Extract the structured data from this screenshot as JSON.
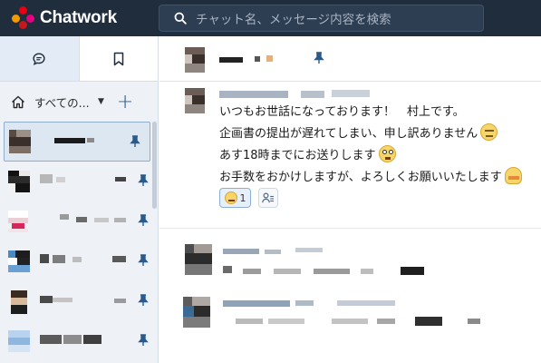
{
  "app": {
    "name": "Chatwork",
    "brand_colors": [
      "#e60012",
      "#f39800",
      "#e4007f",
      "#c8161d"
    ]
  },
  "search": {
    "placeholder": "チャット名、メッセージ内容を検索",
    "icon": "search-icon"
  },
  "sidebar": {
    "tabs": [
      {
        "name": "chat-list-tab",
        "icon": "chat-bubble-icon",
        "active": true
      },
      {
        "name": "bookmarks-tab",
        "icon": "bookmark-icon",
        "active": false
      }
    ],
    "filter": {
      "home_icon": "home-icon",
      "label": "すべての...",
      "caret": "▼",
      "add_label": "+"
    },
    "rooms": [
      {
        "pinned": true,
        "selected": true
      },
      {
        "pinned": true,
        "selected": false
      },
      {
        "pinned": true,
        "selected": false
      },
      {
        "pinned": true,
        "selected": false
      },
      {
        "pinned": true,
        "selected": false
      },
      {
        "pinned": true,
        "selected": false
      }
    ]
  },
  "chat": {
    "pinned": true,
    "messages": [
      {
        "lines": [
          "いつもお世話になっております！　村上です。",
          "企画書の提出が遅れてしまい、申し訳ありません",
          "あす18時までにお送りします",
          "お手数をおかけしますが、よろしくお願いいたします"
        ],
        "reaction": {
          "emoji": "smile-emoji",
          "count": "1"
        },
        "reaction_add_icon": "add-reaction-icon"
      }
    ]
  },
  "colors": {
    "topbar": "#1f2d3d",
    "sidebar": "#eef1f5",
    "accent": "#2a5a8c",
    "selected_room": "#dde7f2"
  }
}
